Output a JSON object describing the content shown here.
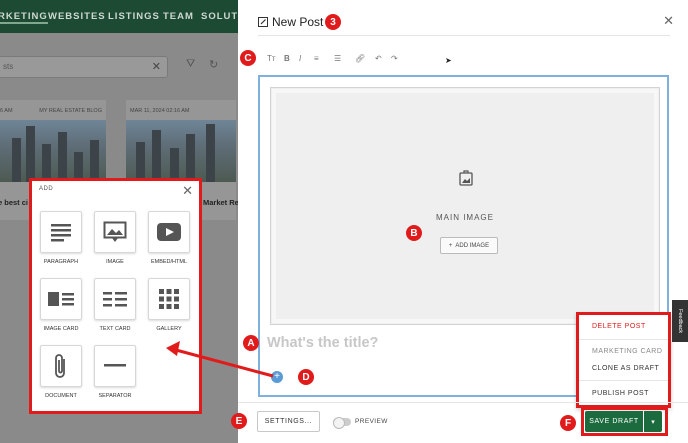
{
  "bg_nav": [
    "RKETING",
    "WEBSITES",
    "LISTINGS",
    "TEAM",
    "SOLUTIO"
  ],
  "bg_search": {
    "placeholder": "sts"
  },
  "bg_cards": [
    {
      "meta_left": "6 AM",
      "meta_right": "MY REAL ESTATE BLOG",
      "title": "e best ci",
      "title2": "hor"
    },
    {
      "meta_left": "MAR 11, 2024 02:16 AM",
      "meta_right": "",
      "title": "Market Re",
      "title2": ""
    }
  ],
  "add_panel": {
    "header": "ADD",
    "blocks": [
      {
        "label": "PARAGRAPH",
        "icon": "paragraph-icon"
      },
      {
        "label": "IMAGE",
        "icon": "image-icon"
      },
      {
        "label": "EMBED/HTML",
        "icon": "youtube-icon"
      },
      {
        "label": "IMAGE CARD",
        "icon": "image-card-icon"
      },
      {
        "label": "TEXT CARD",
        "icon": "text-card-icon"
      },
      {
        "label": "GALLERY",
        "icon": "gallery-icon"
      },
      {
        "label": "DOCUMENT",
        "icon": "paperclip-icon"
      },
      {
        "label": "SEPARATOR",
        "icon": "separator-icon"
      }
    ]
  },
  "modal": {
    "title": "New Post",
    "main_image_label": "MAIN IMAGE",
    "add_image_label": "ADD IMAGE",
    "title_placeholder": "What's the title?",
    "settings_label": "SETTINGS...",
    "preview_label": "PREVIEW",
    "save_label": "SAVE DRAFT",
    "feedback_label": "Feedback"
  },
  "dropdown": {
    "delete": "DELETE POST",
    "section": "MARKETING CARD",
    "clone": "CLONE AS DRAFT",
    "publish": "PUBLISH POST"
  },
  "callouts": {
    "A": "A",
    "B": "B",
    "C": "C",
    "D": "D",
    "E": "E",
    "F": "F",
    "n3": "3"
  },
  "colors": {
    "accent_red": "#e11b1b",
    "save_green": "#1b6b3f",
    "editor_blue": "#7fb1dc",
    "nav_green": "#1c4a33"
  }
}
